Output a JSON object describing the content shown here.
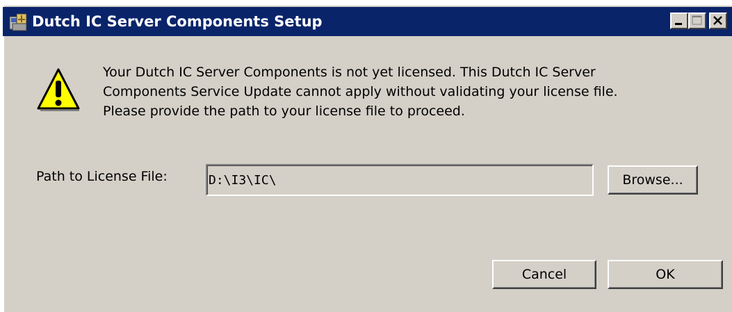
{
  "window": {
    "title": "Dutch IC Server Components Setup",
    "controls": {
      "minimize_icon": "minimize-icon",
      "maximize_icon": "maximize-icon",
      "close_icon": "close-icon"
    }
  },
  "dialog": {
    "icon": "warning-icon",
    "message": "Your Dutch IC Server Components is not yet licensed. This Dutch IC Server Components Service Update cannot apply without validating your license file. Please provide the path to your license file to proceed.",
    "path_label": "Path to License File:",
    "path_value": "D:\\I3\\IC\\",
    "browse_label": "Browse...",
    "cancel_label": "Cancel",
    "ok_label": "OK"
  },
  "colors": {
    "titlebar": "#0a246a",
    "face": "#d4d0c8",
    "warning_fill": "#ffff00"
  }
}
